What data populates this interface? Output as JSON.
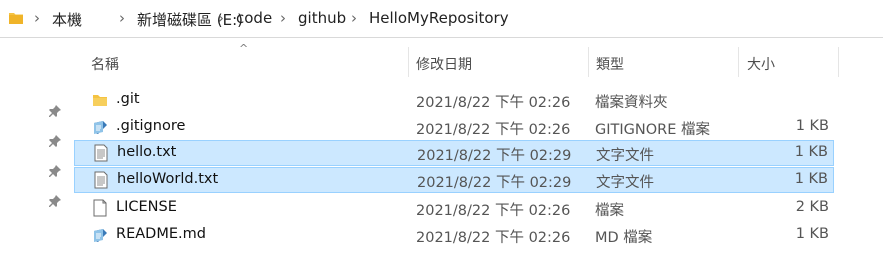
{
  "breadcrumb": [
    "本機",
    "新增磁碟區 (E:)",
    "code",
    "github",
    "HelloMyRepository"
  ],
  "columns": {
    "name": "名稱",
    "date": "修改日期",
    "type": "類型",
    "size": "大小"
  },
  "files": [
    {
      "name": ".git",
      "date": "2021/8/22 下午 02:26",
      "type": "檔案資料夾",
      "size": "",
      "icon": "folder-icon",
      "selected": false
    },
    {
      "name": ".gitignore",
      "date": "2021/8/22 下午 02:26",
      "type": "GITIGNORE 檔案",
      "size": "1 KB",
      "icon": "editor-file-icon",
      "selected": false
    },
    {
      "name": "hello.txt",
      "date": "2021/8/22 下午 02:29",
      "type": "文字文件",
      "size": "1 KB",
      "icon": "text-file-icon",
      "selected": true
    },
    {
      "name": "helloWorld.txt",
      "date": "2021/8/22 下午 02:29",
      "type": "文字文件",
      "size": "1 KB",
      "icon": "text-file-icon",
      "selected": true
    },
    {
      "name": "LICENSE",
      "date": "2021/8/22 下午 02:26",
      "type": "檔案",
      "size": "2 KB",
      "icon": "blank-file-icon",
      "selected": false
    },
    {
      "name": "README.md",
      "date": "2021/8/22 下午 02:26",
      "type": "MD 檔案",
      "size": "1 KB",
      "icon": "editor-file-icon",
      "selected": false
    }
  ],
  "colors": {
    "selection_bg": "#cce8ff",
    "selection_border": "#99d1ff",
    "folder": "#f5c342"
  }
}
